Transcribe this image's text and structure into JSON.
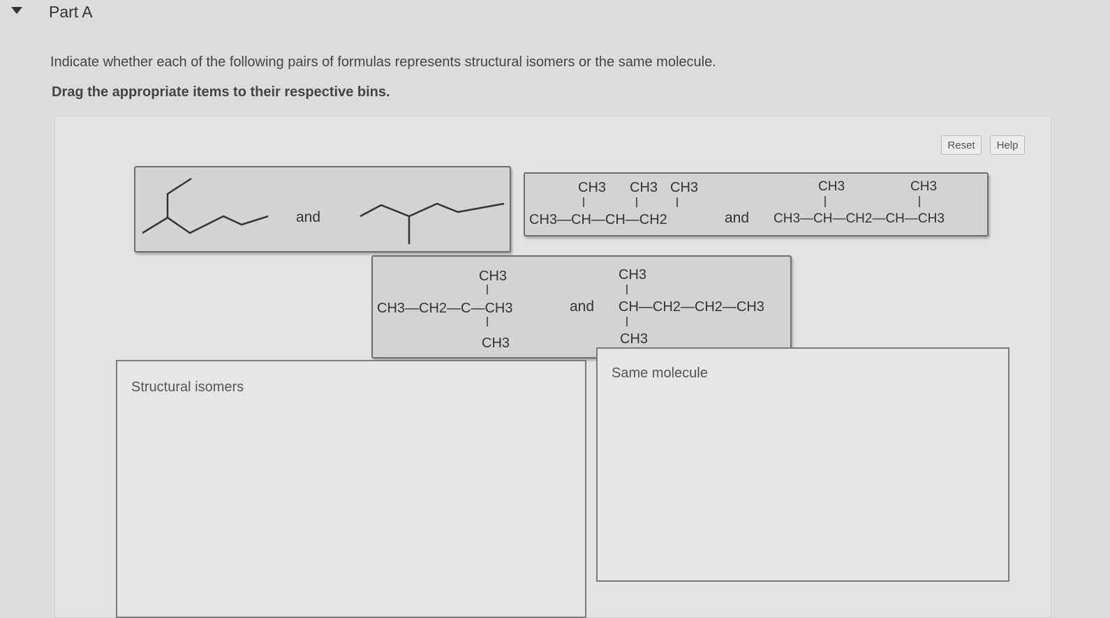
{
  "part": {
    "title": "Part A"
  },
  "instructions": {
    "question": "Indicate whether each of the following pairs of formulas represents structural isomers or the same molecule.",
    "drag": "Drag the appropriate items to their respective bins."
  },
  "buttons": {
    "reset": "Reset",
    "help": "Help"
  },
  "tiles": {
    "skeletal": {
      "and": "and"
    },
    "tile2": {
      "left": {
        "branch1": "CH3",
        "branch2": "CH3",
        "branch3": "CH3",
        "main": "CH3—CH—CH—CH2"
      },
      "and": "and",
      "right": {
        "branch1": "CH3",
        "branch2": "CH3",
        "main": "CH3—CH—CH2—CH—CH3"
      }
    },
    "tile3": {
      "left": {
        "top": "CH3",
        "main": "CH3—CH2—C—CH3",
        "bottom": "CH3"
      },
      "and": "and",
      "right": {
        "top": "CH3",
        "main": "CH—CH2—CH2—CH3",
        "bottom": "CH3"
      }
    }
  },
  "bins": {
    "structural": "Structural isomers",
    "same": "Same molecule"
  }
}
